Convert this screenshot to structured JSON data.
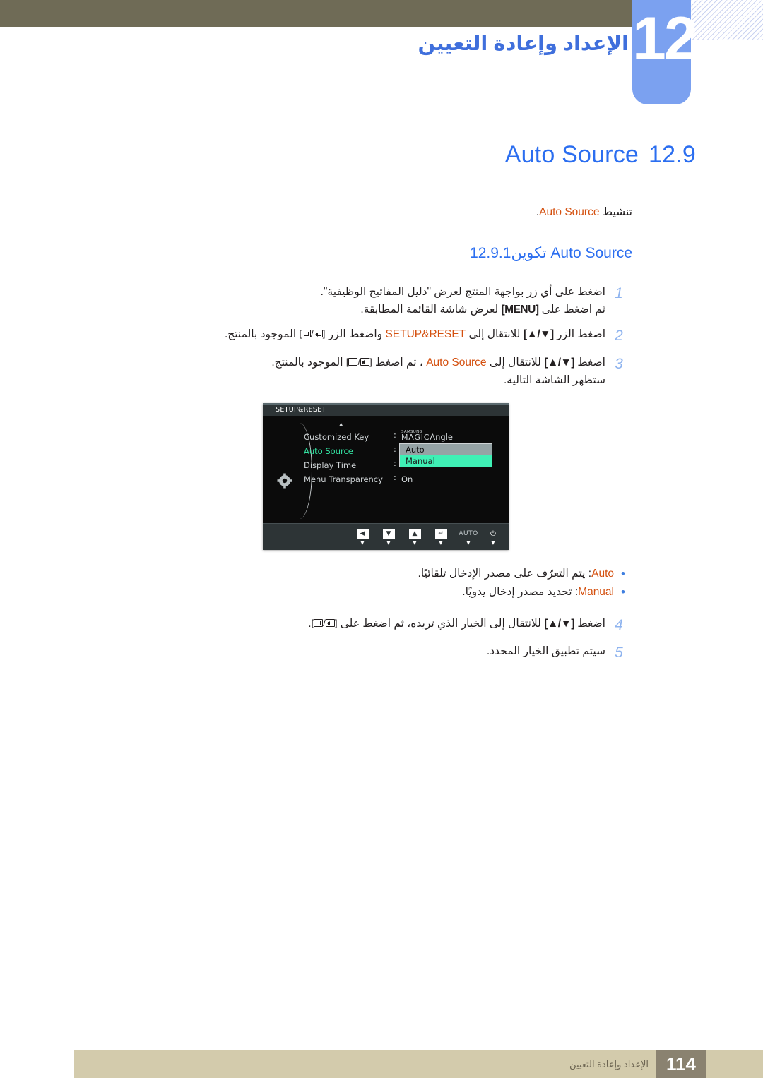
{
  "chapter": {
    "number": "12",
    "title": "الإعداد وإعادة التعيين"
  },
  "section": {
    "number": "12.9",
    "title": "Auto Source",
    "intro_prefix": "تنشيط",
    "intro_keyword": "Auto Source",
    "intro_suffix": "."
  },
  "subsection": {
    "number": "12.9.1",
    "title_arabic": "تكوين",
    "title_latin": "Auto Source"
  },
  "steps": [
    {
      "num": "1",
      "line1_a": "اضغط على أي زر بواجهة المنتج لعرض \"دليل المفاتيح الوظيفية\".",
      "line2_a": "ثم اضغط على",
      "line2_key": "[MENU]",
      "line2_b": "لعرض شاشة القائمة المطابقة."
    },
    {
      "num": "2",
      "a": "اضغط الزر",
      "key1": "[▲/▼]",
      "b": "للانتقال إلى",
      "kw": "SETUP&RESET",
      "c": "واضغط الزر",
      "key2": "[ / ]",
      "d": "الموجود بالمنتج."
    },
    {
      "num": "3",
      "a": "اضغط",
      "key1": "[▲/▼]",
      "b": "للانتقال إلى",
      "kw": "Auto Source",
      "c": "، ثم اضغط",
      "key2": "[ / ]",
      "d": "الموجود بالمنتج.",
      "line2": "ستظهر الشاشة التالية."
    },
    {
      "num": "4",
      "a": "اضغط",
      "key1": "[▲/▼]",
      "b": "للانتقال إلى الخيار الذي تريده، ثم اضغط على",
      "key2": "[ / ]",
      "d": "."
    },
    {
      "num": "5",
      "a": "سيتم تطبيق الخيار المحدد."
    }
  ],
  "bullets": [
    {
      "dot": "•",
      "keyword": "Auto",
      "text": ": يتم التعرّف على مصدر الإدخال تلقائيًا."
    },
    {
      "dot": "•",
      "keyword": "Manual",
      "text": ": تحديد مصدر إدخال يدويًا."
    }
  ],
  "osd": {
    "title": "SETUP&RESET",
    "caret": "▲",
    "menu_items": [
      {
        "label": "Customized Key",
        "selected": false
      },
      {
        "label": "Auto Source",
        "selected": true
      },
      {
        "label": "Display Time",
        "selected": false
      },
      {
        "label": "Menu Transparency",
        "selected": false
      }
    ],
    "colon": ":",
    "values": [
      {
        "type": "magic",
        "brand": "SAMSUNG",
        "magic": "MAGIC",
        "suffix": "Angle"
      },
      {
        "type": "hidden",
        "text": ""
      },
      {
        "type": "hidden",
        "text": ""
      },
      {
        "type": "text",
        "text": "On"
      }
    ],
    "dropdown": {
      "options": [
        {
          "label": "Auto",
          "state": "normal"
        },
        {
          "label": "Manual",
          "state": "highlighted"
        }
      ]
    },
    "buttons": [
      {
        "name": "left",
        "glyph": "◀",
        "type": "sq",
        "tick": "▼"
      },
      {
        "name": "down",
        "glyph": "▼",
        "type": "sq",
        "tick": "▼"
      },
      {
        "name": "up",
        "glyph": "▲",
        "type": "sq",
        "tick": "▼"
      },
      {
        "name": "enter",
        "glyph": "↵",
        "type": "sq",
        "tick": "▼"
      },
      {
        "name": "auto",
        "glyph": "AUTO",
        "type": "lbl",
        "tick": "▼"
      },
      {
        "name": "power",
        "glyph": "⏻",
        "type": "b",
        "tick": "▼"
      }
    ]
  },
  "footer": {
    "page": "114",
    "text": "الإعداد وإعادة التعيين"
  },
  "colors": {
    "header_bar": "#6f6b56",
    "chapter_tab": "#7ba1f0",
    "heading_blue": "#2b6ef0",
    "keyword_orange": "#d4500f",
    "step_number": "#8fb4ef",
    "footer_bar": "#d3cbac",
    "footer_page": "#8a8270",
    "osd_selected_green": "#33e0a0",
    "osd_highlight": "#3ff0b5"
  }
}
